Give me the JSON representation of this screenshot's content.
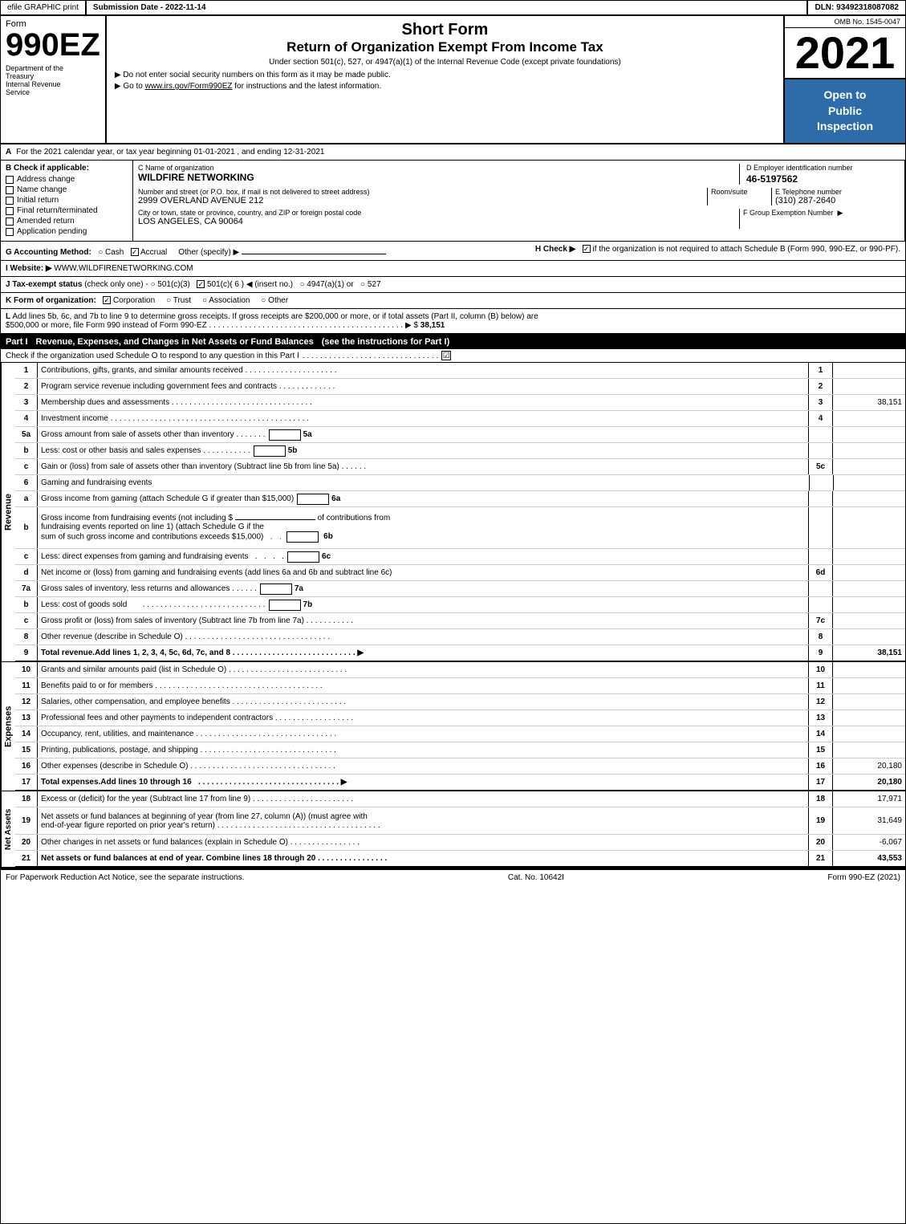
{
  "header": {
    "efile_label": "efile GRAPHIC print",
    "submission_date_label": "Submission Date - 2022-11-14",
    "dln_label": "DLN: 93492318087082",
    "form_label": "Form",
    "form_number": "990EZ",
    "dept_line1": "Department of the",
    "dept_line2": "Treasury",
    "dept_line3": "Internal Revenue",
    "dept_line4": "Service",
    "short_form": "Short Form",
    "return_title": "Return of Organization Exempt From Income Tax",
    "under_section": "Under section 501(c), 527, or 4947(a)(1) of the Internal Revenue Code (except private foundations)",
    "bullet1": "▶ Do not enter social security numbers on this form as it may be made public.",
    "bullet2": "▶ Go to www.irs.gov/Form990EZ for instructions and the latest information.",
    "year": "2021",
    "open_to_public": "Open to\nPublic\nInspection",
    "omb": "OMB No. 1545-0047"
  },
  "section_a": {
    "label": "A",
    "text": "For the 2021 calendar year, or tax year beginning 01-01-2021 , and ending 12-31-2021"
  },
  "section_b": {
    "label": "B Check if applicable:",
    "items": [
      {
        "id": "address_change",
        "label": "Address change",
        "checked": false
      },
      {
        "id": "name_change",
        "label": "Name change",
        "checked": false
      },
      {
        "id": "initial_return",
        "label": "Initial return",
        "checked": false
      },
      {
        "id": "final_return",
        "label": "Final return/terminated",
        "checked": false
      },
      {
        "id": "amended_return",
        "label": "Amended return",
        "checked": false
      },
      {
        "id": "application_pending",
        "label": "Application pending",
        "checked": false
      }
    ]
  },
  "org": {
    "name_label": "C Name of organization",
    "name": "WILDFIRE NETWORKING",
    "address_label": "Number and street (or P.O. box, if mail is not delivered to street address)",
    "address": "2999 OVERLAND AVENUE 212",
    "room_label": "Room/suite",
    "room": "",
    "city_label": "City or town, state or province, country, and ZIP or foreign postal code",
    "city": "LOS ANGELES, CA  90064",
    "ein_label": "D Employer identification number",
    "ein": "46-5197562",
    "phone_label": "E Telephone number",
    "phone": "(310) 287-2640",
    "fgroup_label": "F Group Exemption Number",
    "fgroup_arrow": "▶",
    "fgroup": ""
  },
  "accounting": {
    "label": "G Accounting Method:",
    "cash_label": "○ Cash",
    "accrual_label": "✓ Accrual",
    "other_label": "Other (specify) ▶",
    "h_label": "H Check ▶",
    "h_check_symbol": "✓",
    "h_text": "if the organization is not required to attach Schedule B (Form 990, 990-EZ, or 990-PF)."
  },
  "website": {
    "label": "I Website: ▶",
    "url": "WWW.WILDFIRENETWORKING.COM"
  },
  "tax_exempt": {
    "label": "J Tax-exempt status",
    "note": "(check only one) -",
    "options": [
      {
        "id": "501c3",
        "label": "○ 501(c)(3)",
        "checked": false
      },
      {
        "id": "501c6",
        "label": "✓ 501(c)( 6 ) ◀ (insert no.)",
        "checked": true
      },
      {
        "id": "4947a1",
        "label": "○ 4947(a)(1) or",
        "checked": false
      },
      {
        "id": "527",
        "label": "○ 527",
        "checked": false
      }
    ]
  },
  "form_org": {
    "label": "K Form of organization:",
    "options": [
      {
        "id": "corporation",
        "label": "✓ Corporation",
        "checked": true
      },
      {
        "id": "trust",
        "label": "○ Trust",
        "checked": false
      },
      {
        "id": "association",
        "label": "○ Association",
        "checked": false
      },
      {
        "id": "other",
        "label": "○ Other",
        "checked": false
      }
    ]
  },
  "gross_receipts": {
    "line_l": "L Add lines 5b, 6c, and 7b to line 9 to determine gross receipts. If gross receipts are $200,000 or more, or if total assets (Part II, column (B) below) are $500,000 or more, file Form 990 instead of Form 990-EZ",
    "dots": ". . . . . . . . . . . . . . . . . . . . . . . . . . . . . . . . . . . . . . . . . . . .",
    "arrow": "▶ $",
    "amount": "38,151"
  },
  "part1": {
    "label": "Part I",
    "title": "Revenue, Expenses, and Changes in Net Assets or Fund Balances",
    "see_instructions": "(see the instructions for Part I)",
    "check_label": "Check if the organization used Schedule O to respond to any question in this Part I",
    "check_dots": ". . . . . . . . . . . . . . . . . . . . . . . . . . . . . . .",
    "check_box": "☑",
    "rows": [
      {
        "num": "1",
        "desc": "Contributions, gifts, grants, and similar amounts received",
        "dots": ". . . . . . . . . . . . . . . . . . . . .",
        "ref": "1",
        "amount": ""
      },
      {
        "num": "2",
        "desc": "Program service revenue including government fees and contracts",
        "dots": ". . . . . . . . . . . . . .",
        "ref": "2",
        "amount": ""
      },
      {
        "num": "3",
        "desc": "Membership dues and assessments",
        "dots": ". . . . . . . . . . . . . . . . . . . . . . . . . . . . . . . . .",
        "ref": "3",
        "amount": "38,151"
      },
      {
        "num": "4",
        "desc": "Investment income",
        "dots": ". . . . . . . . . . . . . . . . . . . . . . . . . . . . . . . . . . . . . . . . . . . . . .",
        "ref": "4",
        "amount": ""
      }
    ],
    "row5a": {
      "num": "5a",
      "desc": "Gross amount from sale of assets other than inventory",
      "dots": ". . . . . . .",
      "ref": "5a",
      "amount": ""
    },
    "row5b": {
      "num": "b",
      "desc": "Less: cost or other basis and sales expenses",
      "dots": ". . . . . . . . . . .",
      "ref": "5b",
      "amount": ""
    },
    "row5c": {
      "num": "c",
      "desc": "Gain or (loss) from sale of assets other than inventory (Subtract line 5b from line 5a)",
      "dots": ". . . . . .",
      "ref": "5c",
      "amount": ""
    },
    "row6": {
      "num": "6",
      "desc": "Gaming and fundraising events",
      "ref": "",
      "amount": ""
    },
    "row6a": {
      "num": "a",
      "desc": "Gross income from gaming (attach Schedule G if greater than $15,000)",
      "ref": "6a",
      "amount": ""
    },
    "row6b_desc": "Gross income from fundraising events (not including $",
    "row6b_blank": "_______________",
    "row6b_of": "of contributions from",
    "row6b_desc2": "fundraising events reported on line 1) (attach Schedule G if the",
    "row6b_desc3": "sum of such gross income and contributions exceeds $15,000)",
    "row6b_dots": ". .",
    "row6b_ref": "6b",
    "row6c": {
      "num": "c",
      "desc": "Less: direct expenses from gaming and fundraising events",
      "dots": ". . . .",
      "ref": "6c",
      "amount": ""
    },
    "row6d": {
      "num": "d",
      "desc": "Net income or (loss) from gaming and fundraising events (add lines 6a and 6b and subtract line 6c)",
      "ref": "6d",
      "amount": ""
    },
    "row7a": {
      "num": "7a",
      "desc": "Gross sales of inventory, less returns and allowances",
      "dots": ". . . . . .",
      "ref": "7a",
      "amount": ""
    },
    "row7b": {
      "num": "b",
      "desc": "Less: cost of goods sold",
      "dots": ". . . . . . . . . . . . . . . . . . . . . . . . . . . . . .",
      "ref": "7b",
      "amount": ""
    },
    "row7c": {
      "num": "c",
      "desc": "Gross profit or (loss) from sales of inventory (Subtract line 7b from line 7a)",
      "dots": ". . . . . . . . . . .",
      "ref": "7c",
      "amount": ""
    },
    "row8": {
      "num": "8",
      "desc": "Other revenue (describe in Schedule O)",
      "dots": ". . . . . . . . . . . . . . . . . . . . . . . . . . . . . . . . . . . .",
      "ref": "8",
      "amount": ""
    },
    "row9": {
      "num": "9",
      "desc": "Total revenue. Add lines 1, 2, 3, 4, 5c, 6d, 7c, and 8",
      "dots": ". . . . . . . . . . . . . . . . . . . . . . . . . . . .",
      "arrow": "▶",
      "ref": "9",
      "amount": "38,151"
    }
  },
  "expenses": {
    "rows": [
      {
        "num": "10",
        "desc": "Grants and similar amounts paid (list in Schedule O)",
        "dots": ". . . . . . . . . . . . . . . . . . . . . . . . . . . .",
        "ref": "10",
        "amount": ""
      },
      {
        "num": "11",
        "desc": "Benefits paid to or for members",
        "dots": ". . . . . . . . . . . . . . . . . . . . . . . . . . . . . . . . . . . . . . . . .",
        "ref": "11",
        "amount": ""
      },
      {
        "num": "12",
        "desc": "Salaries, other compensation, and employee benefits",
        "dots": ". . . . . . . . . . . . . . . . . . . . . . . . . . . .",
        "ref": "12",
        "amount": ""
      },
      {
        "num": "13",
        "desc": "Professional fees and other payments to independent contractors",
        "dots": ". . . . . . . . . . . . . . . . . . . .",
        "ref": "13",
        "amount": ""
      },
      {
        "num": "14",
        "desc": "Occupancy, rent, utilities, and maintenance",
        "dots": ". . . . . . . . . . . . . . . . . . . . . . . . . . . . . . . . . . . .",
        "ref": "14",
        "amount": ""
      },
      {
        "num": "15",
        "desc": "Printing, publications, postage, and shipping",
        "dots": ". . . . . . . . . . . . . . . . . . . . . . . . . . . . . . . . . . . .",
        "ref": "15",
        "amount": ""
      },
      {
        "num": "16",
        "desc": "Other expenses (describe in Schedule O)",
        "dots": ". . . . . . . . . . . . . . . . . . . . . . . . . . . . . . . . . . .",
        "ref": "16",
        "amount": "20,180"
      },
      {
        "num": "17",
        "desc": "Total expenses. Add lines 10 through 16",
        "dots": ". . . . . . . . . . . . . . . . . . . . . . . . . . . . . . . . .",
        "arrow": "▶",
        "ref": "17",
        "amount": "20,180",
        "bold": true
      }
    ]
  },
  "net_assets": {
    "rows": [
      {
        "num": "18",
        "desc": "Excess or (deficit) for the year (Subtract line 17 from line 9)",
        "dots": ". . . . . . . . . . . . . . . . . . . . . . . . . .",
        "ref": "18",
        "amount": "17,971"
      },
      {
        "num": "19",
        "desc": "Net assets or fund balances at beginning of year (from line 27, column (A)) (must agree with end-of-year figure reported on prior year's return)",
        "dots": ". . . . . . . . . . . . . . . . . . . . . . . . . . . . . . . . . . . . . .",
        "ref": "19",
        "amount": "31,649"
      },
      {
        "num": "20",
        "desc": "Other changes in net assets or fund balances (explain in Schedule O)",
        "dots": ". . . . . . . . . . . . . . . . . . . .",
        "ref": "20",
        "amount": "-6,067"
      },
      {
        "num": "21",
        "desc": "Net assets or fund balances at end of year. Combine lines 18 through 20",
        "dots": ". . . . . . . . . . . . . . . . . . . . . .",
        "ref": "21",
        "amount": "43,553"
      }
    ]
  },
  "footer": {
    "paperwork_notice": "For Paperwork Reduction Act Notice, see the separate instructions.",
    "cat_no": "Cat. No. 10642I",
    "form_label": "Form 990-EZ (2021)"
  }
}
